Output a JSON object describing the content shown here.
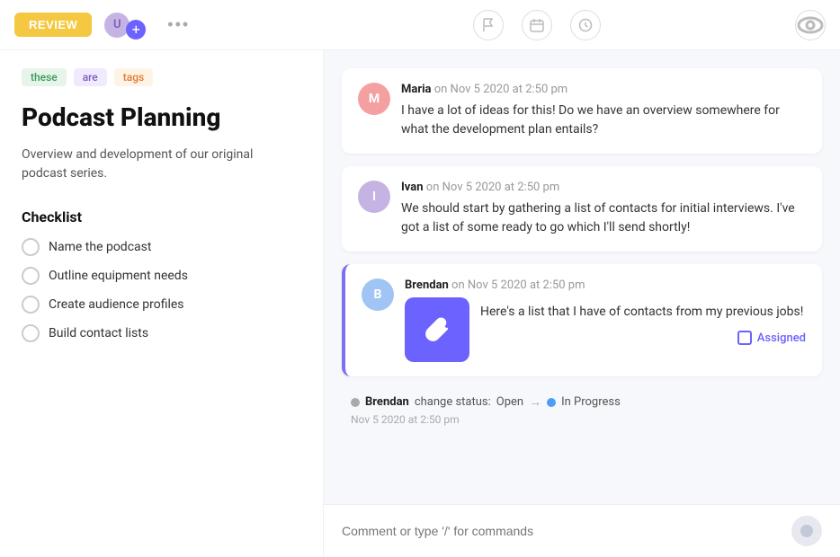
{
  "toolbar": {
    "review_label": "REVIEW",
    "more_label": "•••",
    "icons": {
      "flag": "flag",
      "calendar": "calendar",
      "clock": "clock",
      "eye": "eye"
    }
  },
  "left": {
    "tags": [
      {
        "label": "these",
        "style": "green"
      },
      {
        "label": "are",
        "style": "purple"
      },
      {
        "label": "tags",
        "style": "orange"
      }
    ],
    "title": "Podcast Planning",
    "description": "Overview and development of our original podcast series.",
    "checklist_heading": "Checklist",
    "checklist_items": [
      {
        "label": "Name the podcast"
      },
      {
        "label": "Outline equipment needs"
      },
      {
        "label": "Create audience profiles"
      },
      {
        "label": "Build contact lists"
      }
    ]
  },
  "right": {
    "comments": [
      {
        "id": "maria",
        "author": "Maria",
        "timestamp": "on Nov 5 2020 at 2:50 pm",
        "text": "I have a lot of ideas for this! Do we have an overview somewhere for what the development plan entails?",
        "avatar_color": "maria"
      },
      {
        "id": "ivan",
        "author": "Ivan",
        "timestamp": "on Nov 5 2020 at 2:50 pm",
        "text": "We should start by gathering a list of contacts for initial interviews. I've got a list of some ready to go which I'll send shortly!",
        "avatar_color": "ivan"
      }
    ],
    "brendan_comment": {
      "author": "Brendan",
      "timestamp": "on Nov 5 2020 at 2:50 pm",
      "text": "Here's a list that I have of contacts from my previous jobs!",
      "assigned_label": "Assigned"
    },
    "status_change": {
      "author": "Brendan",
      "prefix": "change status:",
      "from": "Open",
      "to": "In Progress",
      "timestamp": "Nov 5 2020 at 2:50 pm"
    },
    "input_placeholder": "Comment or type '/' for commands"
  }
}
